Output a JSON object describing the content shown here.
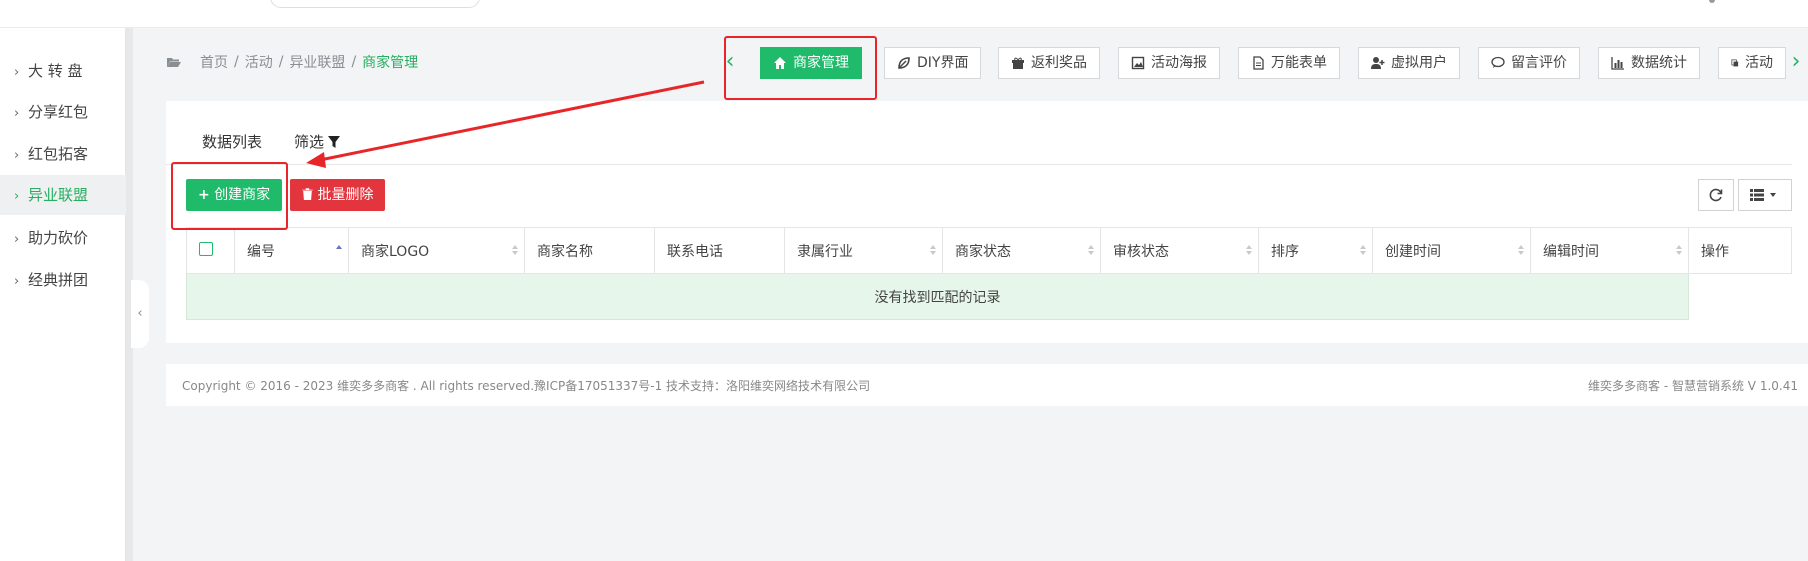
{
  "sidebar": {
    "items": [
      {
        "label": "大 转 盘",
        "active": false
      },
      {
        "label": "分享红包",
        "active": false
      },
      {
        "label": "红包拓客",
        "active": false
      },
      {
        "label": "异业联盟",
        "active": true
      },
      {
        "label": "助力砍价",
        "active": false
      },
      {
        "label": "经典拼团",
        "active": false
      }
    ],
    "collapse_icon": "‹"
  },
  "breadcrumb": {
    "home": "首页",
    "sep": "/",
    "level1": "活动",
    "level2": "异业联盟",
    "current": "商家管理"
  },
  "tabs": [
    {
      "label": "商家管理",
      "icon": "home-icon",
      "active": true
    },
    {
      "label": "DIY界面",
      "icon": "leaf-icon",
      "active": false
    },
    {
      "label": "返利奖品",
      "icon": "gift-icon",
      "active": false
    },
    {
      "label": "活动海报",
      "icon": "image-icon",
      "active": false
    },
    {
      "label": "万能表单",
      "icon": "file-icon",
      "active": false
    },
    {
      "label": "虚拟用户",
      "icon": "user-plus-icon",
      "active": false
    },
    {
      "label": "留言评价",
      "icon": "comment-icon",
      "active": false
    },
    {
      "label": "数据统计",
      "icon": "bar-chart-icon",
      "active": false
    },
    {
      "label": "活动",
      "icon": "copy-icon",
      "active": false
    }
  ],
  "subtabs": {
    "list": "数据列表",
    "filter": "筛选"
  },
  "actions": {
    "create": "创建商家",
    "batch_delete": "批量删除"
  },
  "table": {
    "columns": [
      "编号",
      "商家LOGO",
      "商家名称",
      "联系电话",
      "隶属行业",
      "商家状态",
      "审核状态",
      "排序",
      "创建时间",
      "编辑时间",
      "操作"
    ],
    "empty_text": "没有找到匹配的记录"
  },
  "footer": {
    "copyright": "Copyright © 2016 - 2023 维奕多多商客 . All rights reserved.豫ICP备17051337号-1 技术支持：洛阳维奕网络技术有限公司",
    "version": "维奕多多商客 - 智慧营销系统 V 1.0.41"
  },
  "colors": {
    "accent": "#1fba6a",
    "danger": "#e2353e",
    "annotation": "#e8262a"
  }
}
